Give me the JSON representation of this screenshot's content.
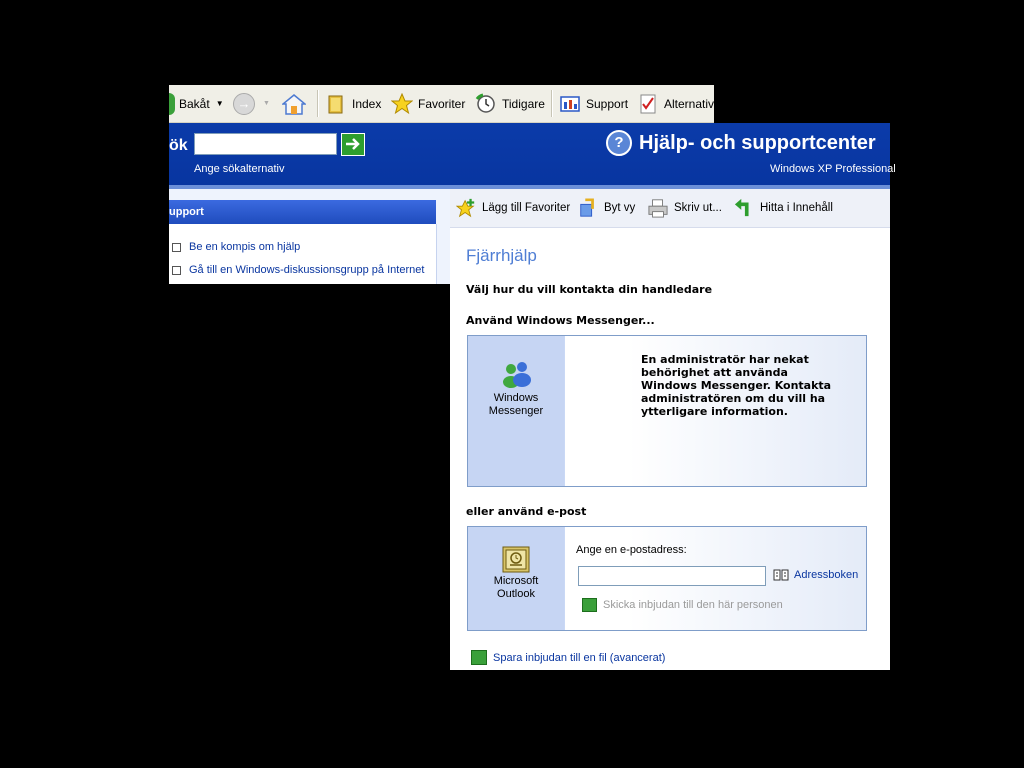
{
  "toolbar": {
    "back": "Bakåt",
    "index": "Index",
    "favorites": "Favoriter",
    "history": "Tidigare",
    "support": "Support",
    "options": "Alternativ"
  },
  "header": {
    "search_label": "ök",
    "search_value": "",
    "search_options": "Ange sökalternativ",
    "title": "Hjälp- och supportcenter",
    "edition": "Windows XP Professional"
  },
  "left_pane": {
    "heading": "upport",
    "items": [
      {
        "label": "Be en kompis om hjälp"
      },
      {
        "label": "Gå till en Windows-diskussionsgrupp på Internet"
      }
    ]
  },
  "content_toolbar": {
    "add_favorites": "Lägg till Favoriter",
    "change_view": "Byt vy",
    "print": "Skriv ut...",
    "find_in_contents": "Hitta i Innehåll"
  },
  "main": {
    "title": "Fjärrhjälp",
    "subtitle": "Välj hur du vill kontakta din handledare",
    "messenger_heading": "Använd Windows Messenger...",
    "messenger_app": [
      "Windows",
      "Messenger"
    ],
    "messenger_message": "En administratör har nekat behörighet att använda Windows Messenger. Kontakta administratören om du vill ha ytterligare information.",
    "email_heading": "eller använd e-post",
    "outlook_app": [
      "Microsoft",
      "Outlook"
    ],
    "email_label": "Ange en e-postadress:",
    "email_value": "",
    "addressbook": "Adressboken",
    "send_invite": "Skicka inbjudan till den här personen",
    "save_invite": "Spara inbjudan till en fil (avancerat)"
  },
  "colors": {
    "header_blue": "#0a3aa5",
    "title_blue": "#4f7ed4",
    "link_blue": "#0a36a0"
  }
}
